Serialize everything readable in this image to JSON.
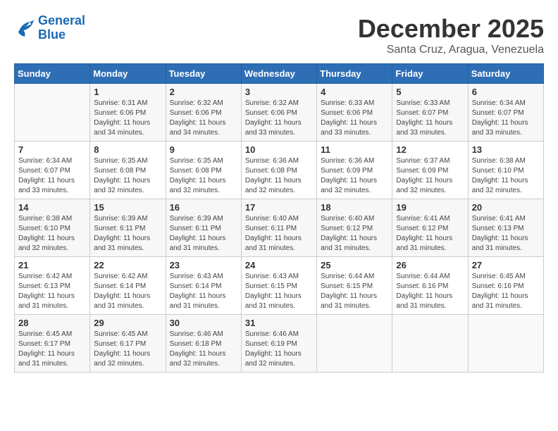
{
  "header": {
    "logo_line1": "General",
    "logo_line2": "Blue",
    "month_title": "December 2025",
    "location": "Santa Cruz, Aragua, Venezuela"
  },
  "days_of_week": [
    "Sunday",
    "Monday",
    "Tuesday",
    "Wednesday",
    "Thursday",
    "Friday",
    "Saturday"
  ],
  "weeks": [
    [
      {
        "day": "",
        "sunrise": "",
        "sunset": "",
        "daylight": ""
      },
      {
        "day": "1",
        "sunrise": "Sunrise: 6:31 AM",
        "sunset": "Sunset: 6:06 PM",
        "daylight": "Daylight: 11 hours and 34 minutes."
      },
      {
        "day": "2",
        "sunrise": "Sunrise: 6:32 AM",
        "sunset": "Sunset: 6:06 PM",
        "daylight": "Daylight: 11 hours and 34 minutes."
      },
      {
        "day": "3",
        "sunrise": "Sunrise: 6:32 AM",
        "sunset": "Sunset: 6:06 PM",
        "daylight": "Daylight: 11 hours and 33 minutes."
      },
      {
        "day": "4",
        "sunrise": "Sunrise: 6:33 AM",
        "sunset": "Sunset: 6:06 PM",
        "daylight": "Daylight: 11 hours and 33 minutes."
      },
      {
        "day": "5",
        "sunrise": "Sunrise: 6:33 AM",
        "sunset": "Sunset: 6:07 PM",
        "daylight": "Daylight: 11 hours and 33 minutes."
      },
      {
        "day": "6",
        "sunrise": "Sunrise: 6:34 AM",
        "sunset": "Sunset: 6:07 PM",
        "daylight": "Daylight: 11 hours and 33 minutes."
      }
    ],
    [
      {
        "day": "7",
        "sunrise": "Sunrise: 6:34 AM",
        "sunset": "Sunset: 6:07 PM",
        "daylight": "Daylight: 11 hours and 33 minutes."
      },
      {
        "day": "8",
        "sunrise": "Sunrise: 6:35 AM",
        "sunset": "Sunset: 6:08 PM",
        "daylight": "Daylight: 11 hours and 32 minutes."
      },
      {
        "day": "9",
        "sunrise": "Sunrise: 6:35 AM",
        "sunset": "Sunset: 6:08 PM",
        "daylight": "Daylight: 11 hours and 32 minutes."
      },
      {
        "day": "10",
        "sunrise": "Sunrise: 6:36 AM",
        "sunset": "Sunset: 6:08 PM",
        "daylight": "Daylight: 11 hours and 32 minutes."
      },
      {
        "day": "11",
        "sunrise": "Sunrise: 6:36 AM",
        "sunset": "Sunset: 6:09 PM",
        "daylight": "Daylight: 11 hours and 32 minutes."
      },
      {
        "day": "12",
        "sunrise": "Sunrise: 6:37 AM",
        "sunset": "Sunset: 6:09 PM",
        "daylight": "Daylight: 11 hours and 32 minutes."
      },
      {
        "day": "13",
        "sunrise": "Sunrise: 6:38 AM",
        "sunset": "Sunset: 6:10 PM",
        "daylight": "Daylight: 11 hours and 32 minutes."
      }
    ],
    [
      {
        "day": "14",
        "sunrise": "Sunrise: 6:38 AM",
        "sunset": "Sunset: 6:10 PM",
        "daylight": "Daylight: 11 hours and 32 minutes."
      },
      {
        "day": "15",
        "sunrise": "Sunrise: 6:39 AM",
        "sunset": "Sunset: 6:11 PM",
        "daylight": "Daylight: 11 hours and 31 minutes."
      },
      {
        "day": "16",
        "sunrise": "Sunrise: 6:39 AM",
        "sunset": "Sunset: 6:11 PM",
        "daylight": "Daylight: 11 hours and 31 minutes."
      },
      {
        "day": "17",
        "sunrise": "Sunrise: 6:40 AM",
        "sunset": "Sunset: 6:11 PM",
        "daylight": "Daylight: 11 hours and 31 minutes."
      },
      {
        "day": "18",
        "sunrise": "Sunrise: 6:40 AM",
        "sunset": "Sunset: 6:12 PM",
        "daylight": "Daylight: 11 hours and 31 minutes."
      },
      {
        "day": "19",
        "sunrise": "Sunrise: 6:41 AM",
        "sunset": "Sunset: 6:12 PM",
        "daylight": "Daylight: 11 hours and 31 minutes."
      },
      {
        "day": "20",
        "sunrise": "Sunrise: 6:41 AM",
        "sunset": "Sunset: 6:13 PM",
        "daylight": "Daylight: 11 hours and 31 minutes."
      }
    ],
    [
      {
        "day": "21",
        "sunrise": "Sunrise: 6:42 AM",
        "sunset": "Sunset: 6:13 PM",
        "daylight": "Daylight: 11 hours and 31 minutes."
      },
      {
        "day": "22",
        "sunrise": "Sunrise: 6:42 AM",
        "sunset": "Sunset: 6:14 PM",
        "daylight": "Daylight: 11 hours and 31 minutes."
      },
      {
        "day": "23",
        "sunrise": "Sunrise: 6:43 AM",
        "sunset": "Sunset: 6:14 PM",
        "daylight": "Daylight: 11 hours and 31 minutes."
      },
      {
        "day": "24",
        "sunrise": "Sunrise: 6:43 AM",
        "sunset": "Sunset: 6:15 PM",
        "daylight": "Daylight: 11 hours and 31 minutes."
      },
      {
        "day": "25",
        "sunrise": "Sunrise: 6:44 AM",
        "sunset": "Sunset: 6:15 PM",
        "daylight": "Daylight: 11 hours and 31 minutes."
      },
      {
        "day": "26",
        "sunrise": "Sunrise: 6:44 AM",
        "sunset": "Sunset: 6:16 PM",
        "daylight": "Daylight: 11 hours and 31 minutes."
      },
      {
        "day": "27",
        "sunrise": "Sunrise: 6:45 AM",
        "sunset": "Sunset: 6:16 PM",
        "daylight": "Daylight: 11 hours and 31 minutes."
      }
    ],
    [
      {
        "day": "28",
        "sunrise": "Sunrise: 6:45 AM",
        "sunset": "Sunset: 6:17 PM",
        "daylight": "Daylight: 11 hours and 31 minutes."
      },
      {
        "day": "29",
        "sunrise": "Sunrise: 6:45 AM",
        "sunset": "Sunset: 6:17 PM",
        "daylight": "Daylight: 11 hours and 32 minutes."
      },
      {
        "day": "30",
        "sunrise": "Sunrise: 6:46 AM",
        "sunset": "Sunset: 6:18 PM",
        "daylight": "Daylight: 11 hours and 32 minutes."
      },
      {
        "day": "31",
        "sunrise": "Sunrise: 6:46 AM",
        "sunset": "Sunset: 6:19 PM",
        "daylight": "Daylight: 11 hours and 32 minutes."
      },
      {
        "day": "",
        "sunrise": "",
        "sunset": "",
        "daylight": ""
      },
      {
        "day": "",
        "sunrise": "",
        "sunset": "",
        "daylight": ""
      },
      {
        "day": "",
        "sunrise": "",
        "sunset": "",
        "daylight": ""
      }
    ]
  ]
}
